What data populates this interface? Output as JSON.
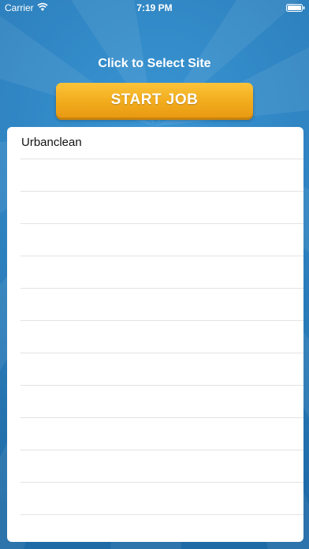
{
  "status_bar": {
    "carrier": "Carrier",
    "time": "7:19 PM"
  },
  "header": {
    "prompt": "Click to Select Site"
  },
  "start_button": {
    "label": "START JOB"
  },
  "sites": [
    {
      "label": "Urbanclean"
    },
    {
      "label": ""
    },
    {
      "label": ""
    },
    {
      "label": ""
    },
    {
      "label": ""
    },
    {
      "label": ""
    },
    {
      "label": ""
    },
    {
      "label": ""
    },
    {
      "label": ""
    },
    {
      "label": ""
    },
    {
      "label": ""
    },
    {
      "label": ""
    },
    {
      "label": ""
    }
  ],
  "colors": {
    "background": "#2d7fbd",
    "button": "#f2ab1d",
    "button_text": "#ffffff",
    "list_background": "#ffffff"
  }
}
